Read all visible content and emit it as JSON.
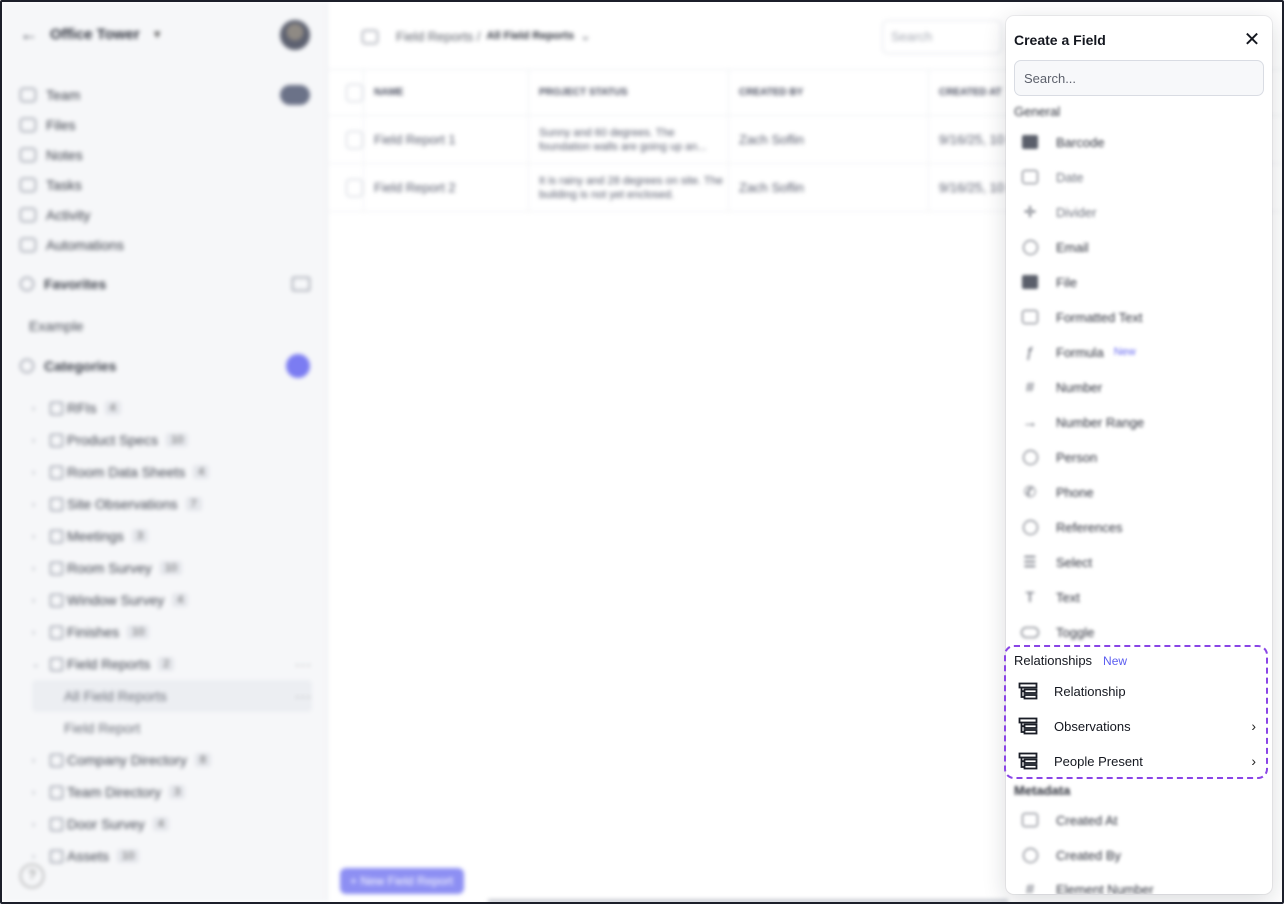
{
  "sidebar": {
    "project": "Office Tower",
    "nav": [
      {
        "label": "Team",
        "icon": "users-icon"
      },
      {
        "label": "Files",
        "icon": "file-icon"
      },
      {
        "label": "Notes",
        "icon": "notes-icon"
      },
      {
        "label": "Tasks",
        "icon": "tasks-icon"
      },
      {
        "label": "Activity",
        "icon": "activity-icon"
      },
      {
        "label": "Automations",
        "icon": "automation-icon"
      }
    ],
    "favorites_label": "Favorites",
    "favorites_example": "Example",
    "categories_label": "Categories",
    "categories": [
      {
        "label": "RFIs",
        "count": "4"
      },
      {
        "label": "Product Specs",
        "count": "10"
      },
      {
        "label": "Room Data Sheets",
        "count": "4"
      },
      {
        "label": "Site Observations",
        "count": "7"
      },
      {
        "label": "Meetings",
        "count": "3"
      },
      {
        "label": "Room Survey",
        "count": "10"
      },
      {
        "label": "Window Survey",
        "count": "4"
      },
      {
        "label": "Finishes",
        "count": "10"
      },
      {
        "label": "Field Reports",
        "count": "2"
      },
      {
        "label": "All Field Reports",
        "count": ""
      },
      {
        "label": "Field Report",
        "count": ""
      },
      {
        "label": "Company Directory",
        "count": "8"
      },
      {
        "label": "Team Directory",
        "count": "3"
      },
      {
        "label": "Door Survey",
        "count": "4"
      },
      {
        "label": "Assets",
        "count": "10"
      }
    ],
    "help": "?"
  },
  "topbar": {
    "crumb_root": "Field Reports /",
    "crumb_current": "All Field Reports",
    "search_placeholder": "Search"
  },
  "table": {
    "headers": [
      "NAME",
      "PROJECT STATUS",
      "CREATED BY",
      "CREATED AT"
    ],
    "rows": [
      {
        "name": "Field Report 1",
        "status": "Sunny and 60 degrees. The foundation walls are going up an...",
        "created_by": "Zach Soflin",
        "created_at": "9/16/25, 10"
      },
      {
        "name": "Field Report 2",
        "status": "It is rainy and 28 degrees on site. The building is not yet enclosed.",
        "created_by": "Zach Soflin",
        "created_at": "9/16/25, 10"
      }
    ]
  },
  "new_button": "+ New Field Report",
  "panel": {
    "title": "Create a Field",
    "close": "✕",
    "search_placeholder": "Search...",
    "general_label": "General",
    "general": [
      {
        "label": "Barcode",
        "icon": "barcode-icon"
      },
      {
        "label": "Date",
        "icon": "calendar-icon"
      },
      {
        "label": "Divider",
        "icon": "divider-icon"
      },
      {
        "label": "Email",
        "icon": "email-icon"
      },
      {
        "label": "File",
        "icon": "file-icon"
      },
      {
        "label": "Formatted Text",
        "icon": "formatted-text-icon"
      },
      {
        "label": "Formula",
        "icon": "formula-icon",
        "badge": "New"
      },
      {
        "label": "Number",
        "icon": "number-icon"
      },
      {
        "label": "Number Range",
        "icon": "number-range-icon"
      },
      {
        "label": "Person",
        "icon": "person-icon"
      },
      {
        "label": "Phone",
        "icon": "phone-icon"
      },
      {
        "label": "References",
        "icon": "references-icon"
      },
      {
        "label": "Select",
        "icon": "select-icon"
      },
      {
        "label": "Text",
        "icon": "text-icon"
      },
      {
        "label": "Toggle",
        "icon": "toggle-icon"
      }
    ],
    "relationships_label": "Relationships",
    "relationships_badge": "New",
    "relationships": [
      {
        "label": "Relationship",
        "icon": "relationship-icon",
        "has_submenu": false
      },
      {
        "label": "Observations",
        "icon": "relationship-icon",
        "has_submenu": true
      },
      {
        "label": "People Present",
        "icon": "relationship-icon",
        "has_submenu": true
      }
    ],
    "metadata_label": "Metadata",
    "metadata": [
      {
        "label": "Created At",
        "icon": "calendar-icon"
      },
      {
        "label": "Created By",
        "icon": "person-icon"
      },
      {
        "label": "Element Number",
        "icon": "hash-icon"
      }
    ]
  },
  "colors": {
    "accent": "#5b5df0",
    "highlight": "#8a45e6"
  }
}
